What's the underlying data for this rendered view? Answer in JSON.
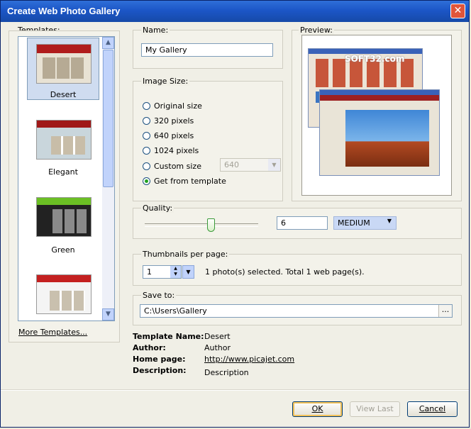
{
  "window": {
    "title": "Create Web Photo Gallery"
  },
  "templates": {
    "label": "Templates:",
    "items": [
      {
        "name": "Desert",
        "selected": true
      },
      {
        "name": "Elegant",
        "selected": false
      },
      {
        "name": "Green",
        "selected": false
      },
      {
        "name": "",
        "selected": false
      }
    ],
    "more_link": "More Templates..."
  },
  "name_section": {
    "label": "Name:",
    "value": "My Gallery"
  },
  "image_size": {
    "label": "Image Size:",
    "options": [
      {
        "label": "Original size",
        "selected": false
      },
      {
        "label": "320 pixels",
        "selected": false
      },
      {
        "label": "640 pixels",
        "selected": false
      },
      {
        "label": "1024 pixels",
        "selected": false
      },
      {
        "label": "Custom size",
        "selected": false
      },
      {
        "label": "Get from template",
        "selected": true
      }
    ],
    "custom_value": "640"
  },
  "preview": {
    "label": "Preview:",
    "watermark": "SOFT32.com"
  },
  "quality": {
    "label": "Quality:",
    "value": "6",
    "level": "MEDIUM",
    "slider_fraction": 0.58
  },
  "thumbnails": {
    "label": "Thumbnails per page:",
    "value": "1",
    "status": "1 photo(s) selected. Total 1 web page(s)."
  },
  "save_to": {
    "label": "Save to:",
    "path": "C:\\Users\\Gallery",
    "browse_label": "..."
  },
  "template_info": {
    "name_key": "Template Name:",
    "name_value": "Desert",
    "author_key": "Author:",
    "author_value": "Author",
    "homepage_key": "Home page:",
    "homepage_value": "http://www.picajet.com",
    "description_key": "Description:",
    "description_value": "Description"
  },
  "buttons": {
    "ok": "OK",
    "view_last": "View Last",
    "cancel": "Cancel"
  }
}
